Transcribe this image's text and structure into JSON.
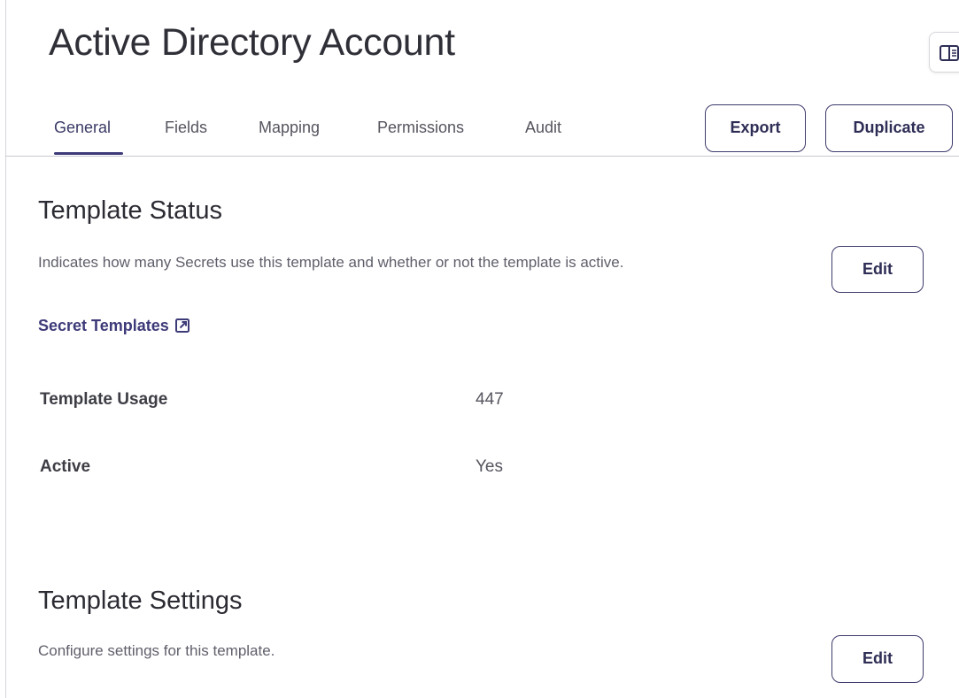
{
  "header": {
    "title": "Active Directory Account"
  },
  "tabs": [
    {
      "label": "General",
      "active": true
    },
    {
      "label": "Fields",
      "active": false
    },
    {
      "label": "Mapping",
      "active": false
    },
    {
      "label": "Permissions",
      "active": false
    },
    {
      "label": "Audit",
      "active": false
    }
  ],
  "actions": {
    "export_label": "Export",
    "duplicate_label": "Duplicate"
  },
  "panel_toggle": {
    "icon": "side-panel-icon"
  },
  "template_status": {
    "title": "Template Status",
    "description": "Indicates how many Secrets use this template and whether or not the template is active.",
    "link_label": "Secret Templates",
    "link_icon": "external-link-icon",
    "edit_label": "Edit",
    "rows": [
      {
        "label": "Template Usage",
        "value": "447"
      },
      {
        "label": "Active",
        "value": "Yes"
      }
    ]
  },
  "template_settings": {
    "title": "Template Settings",
    "description": "Configure settings for this template.",
    "edit_label": "Edit"
  },
  "colors": {
    "accent": "#3d3a78",
    "border": "#c9c9d0"
  }
}
